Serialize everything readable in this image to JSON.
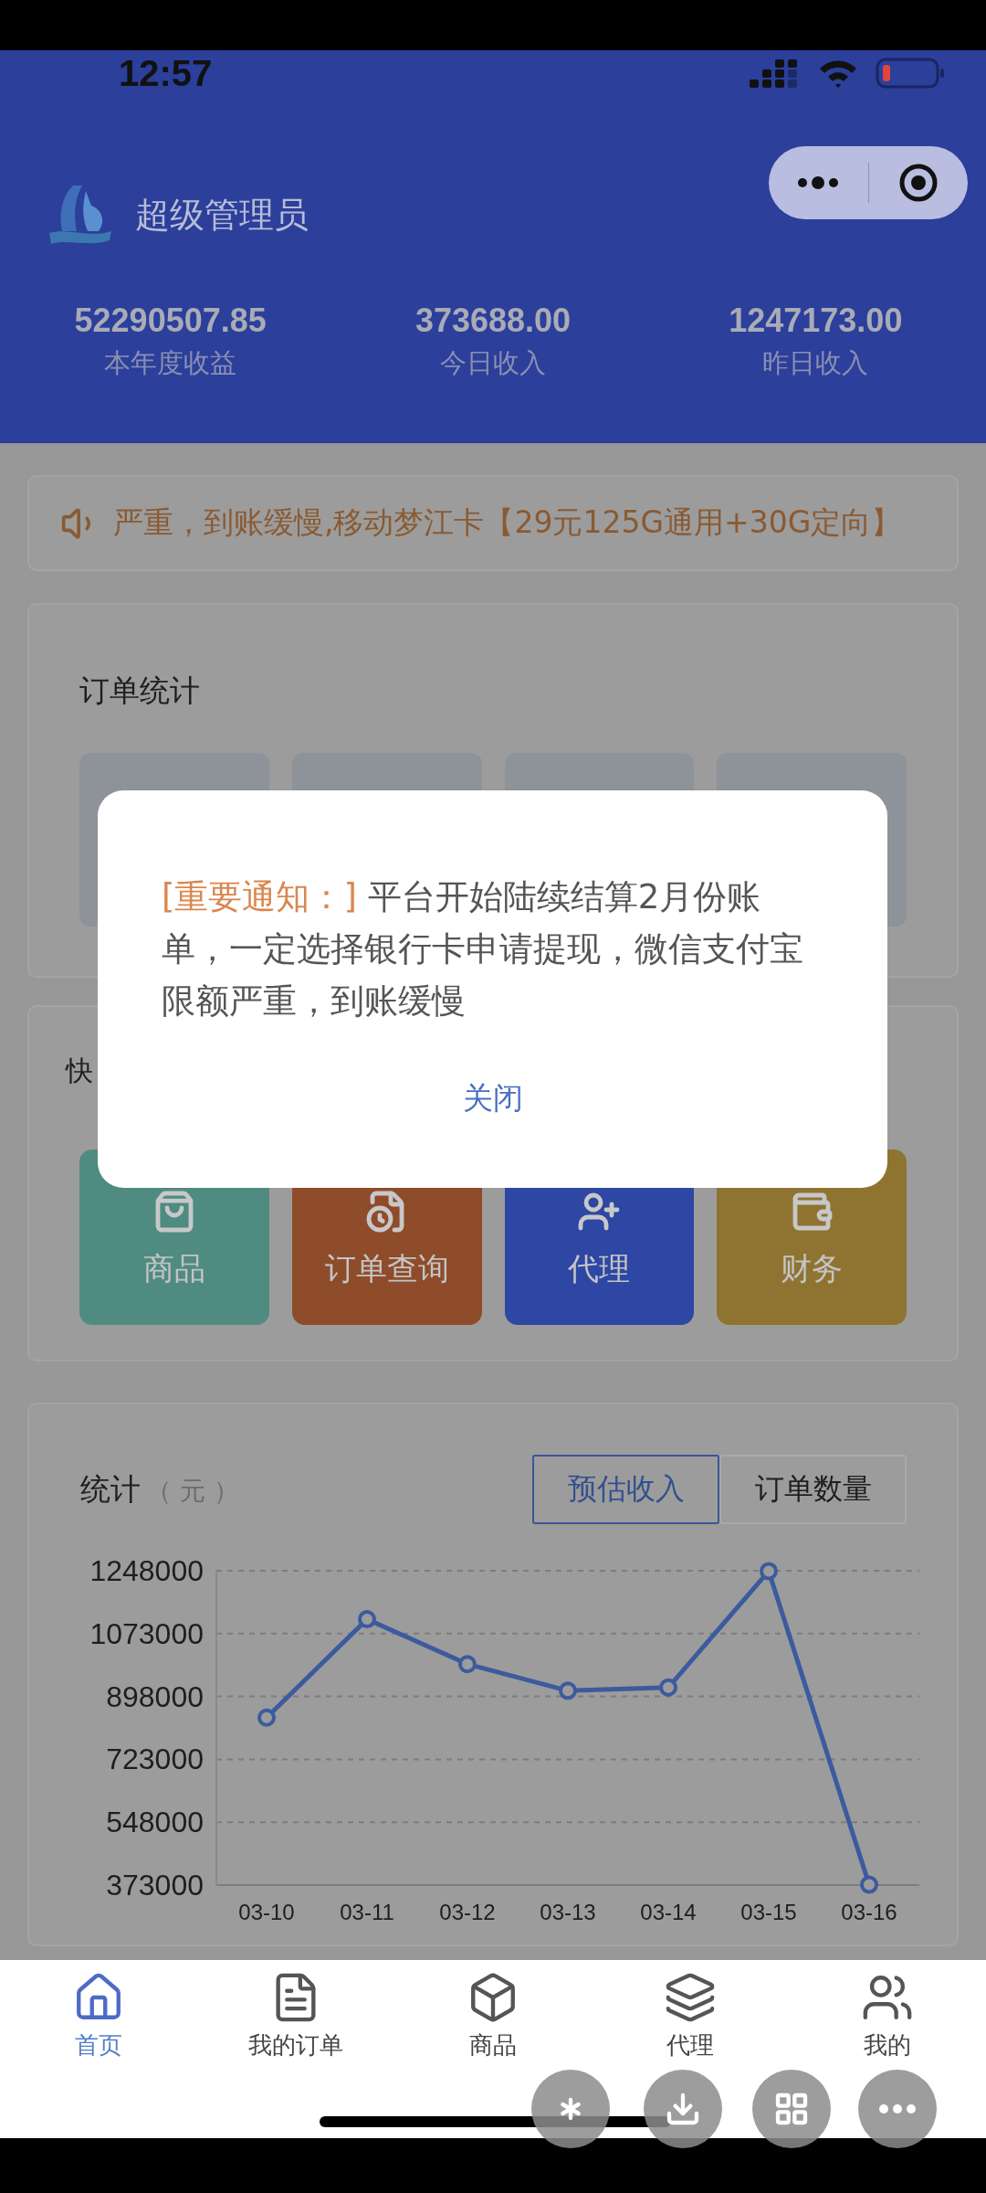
{
  "status_bar": {
    "time": "12:57"
  },
  "header": {
    "title": "超级管理员",
    "stats": [
      {
        "value": "52290507.85",
        "label": "本年度收益"
      },
      {
        "value": "373688.00",
        "label": "今日收入"
      },
      {
        "value": "1247173.00",
        "label": "昨日收入"
      }
    ]
  },
  "marquee": {
    "text": "严重，到账缓慢,移动梦江卡【29元125G通用+30G定向】"
  },
  "order_stats": {
    "title": "订单统计"
  },
  "quick_menu": {
    "title": "快",
    "items": [
      {
        "label": "商品",
        "color": "#4f8b80"
      },
      {
        "label": "订单查询",
        "color": "#8e4c2b"
      },
      {
        "label": "代理",
        "color": "#2e47a4"
      },
      {
        "label": "财务",
        "color": "#8f7431"
      }
    ]
  },
  "stats": {
    "title": "统计",
    "unit": "（ 元 ）",
    "toggles": [
      {
        "label": "预估收入",
        "selected": true
      },
      {
        "label": "订单数量",
        "selected": false
      }
    ],
    "chart_data": {
      "type": "line",
      "categories": [
        "03-10",
        "03-11",
        "03-12",
        "03-13",
        "03-14",
        "03-15",
        "03-16"
      ],
      "series": [
        {
          "color": "#3c5b9e",
          "marker": true,
          "values": [
            839000,
            1113000,
            988000,
            914000,
            923000,
            1247000,
            374000
          ]
        }
      ],
      "grid": true,
      "ylim": [
        373000,
        1248000
      ],
      "yticks": [
        373000,
        548000,
        723000,
        898000,
        1073000,
        1248000
      ]
    }
  },
  "tab_bar": [
    {
      "label": "首页",
      "selected": true
    },
    {
      "label": "我的订单",
      "selected": false
    },
    {
      "label": "商品",
      "selected": false
    },
    {
      "label": "代理",
      "selected": false
    },
    {
      "label": "我的",
      "selected": false
    }
  ],
  "dialog": {
    "tag": "[重要通知：]",
    "text": " 平台开始陆续结算2月份账单，一定选择银行卡申请提现，微信支付宝限额严重，到账缓慢",
    "button": "关闭"
  }
}
